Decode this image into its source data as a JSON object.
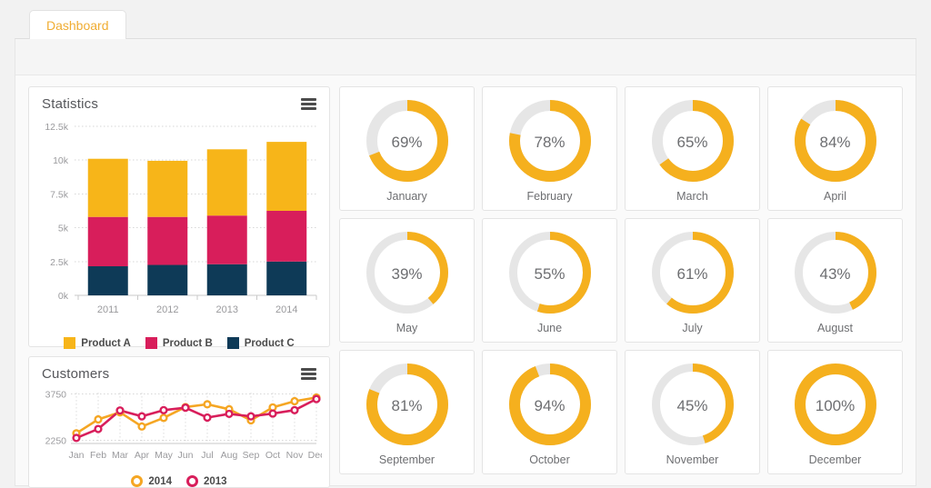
{
  "tabs": [
    {
      "label": "Dashboard",
      "active": true
    }
  ],
  "colors": {
    "accent": "#f0ad33",
    "product_a": "#f7b519",
    "product_b": "#d81e5b",
    "product_c": "#0e3a57",
    "donut_fill": "#f5b01e",
    "donut_track": "#e6e6e6",
    "series_2014": "#f5a623",
    "series_2013": "#d81e5b",
    "page_bg": "#f2f2f2",
    "card_bg": "#ffffff"
  },
  "statistics": {
    "title": "Statistics",
    "menu_icon": "hamburger-menu-icon",
    "chart_data": {
      "type": "bar",
      "stacked": true,
      "title": "Statistics",
      "xlabel": "",
      "ylabel": "",
      "categories": [
        "2011",
        "2012",
        "2013",
        "2014"
      ],
      "ytick_labels": [
        "0k",
        "2.5k",
        "5k",
        "7.5k",
        "10k",
        "12.5k"
      ],
      "ytick_values": [
        0,
        2500,
        5000,
        7500,
        10000,
        12500
      ],
      "ylim": [
        0,
        12500
      ],
      "grid": true,
      "series": [
        {
          "name": "Product C",
          "color": "#0e3a57",
          "values": [
            2150,
            2250,
            2300,
            2500
          ]
        },
        {
          "name": "Product B",
          "color": "#d81e5b",
          "values": [
            3650,
            3550,
            3600,
            3750
          ]
        },
        {
          "name": "Product A",
          "color": "#f7b519",
          "values": [
            4300,
            4150,
            4900,
            5100
          ]
        }
      ],
      "totals": [
        10100,
        9950,
        10800,
        11350
      ],
      "legend": [
        "Product A",
        "Product B",
        "Product C"
      ],
      "legend_position": "bottom"
    }
  },
  "customers": {
    "title": "Customers",
    "menu_icon": "hamburger-menu-icon",
    "chart_data": {
      "type": "line",
      "title": "Customers",
      "xlabel": "",
      "ylabel": "",
      "categories": [
        "Jan",
        "Feb",
        "Mar",
        "Apr",
        "May",
        "Jun",
        "Jul",
        "Aug",
        "Sep",
        "Oct",
        "Nov",
        "Dec"
      ],
      "ytick_labels": [
        "2250",
        "3750"
      ],
      "ytick_values": [
        2250,
        3750
      ],
      "ylim": [
        2150,
        3800
      ],
      "grid": true,
      "markers": "circle-outline",
      "series": [
        {
          "name": "2014",
          "color": "#f5a623",
          "values": [
            2480,
            2930,
            3160,
            2700,
            2980,
            3330,
            3420,
            3260,
            2900,
            3320,
            3520,
            3640
          ]
        },
        {
          "name": "2013",
          "color": "#d81e5b",
          "values": [
            2330,
            2620,
            3220,
            3030,
            3230,
            3310,
            2990,
            3110,
            3030,
            3120,
            3230,
            3590
          ]
        }
      ],
      "legend": [
        "2014",
        "2013"
      ],
      "legend_position": "bottom"
    }
  },
  "donuts": {
    "chart_data": {
      "type": "pie",
      "variant": "donut-grid",
      "unit": "%",
      "items": [
        {
          "label": "January",
          "value": 69,
          "display": "69%",
          "thickness": "thick"
        },
        {
          "label": "February",
          "value": 78,
          "display": "78%",
          "thickness": "thick"
        },
        {
          "label": "March",
          "value": 65,
          "display": "65%",
          "thickness": "thick"
        },
        {
          "label": "April",
          "value": 84,
          "display": "84%",
          "thickness": "thick"
        },
        {
          "label": "May",
          "value": 39,
          "display": "39%",
          "thickness": "thin"
        },
        {
          "label": "June",
          "value": 55,
          "display": "55%",
          "thickness": "thin"
        },
        {
          "label": "July",
          "value": 61,
          "display": "61%",
          "thickness": "thin"
        },
        {
          "label": "August",
          "value": 43,
          "display": "43%",
          "thickness": "thin"
        },
        {
          "label": "September",
          "value": 81,
          "display": "81%",
          "thickness": "thick"
        },
        {
          "label": "October",
          "value": 94,
          "display": "94%",
          "thickness": "thick"
        },
        {
          "label": "November",
          "value": 45,
          "display": "45%",
          "thickness": "thin"
        },
        {
          "label": "December",
          "value": 100,
          "display": "100%",
          "thickness": "thick"
        }
      ]
    }
  }
}
